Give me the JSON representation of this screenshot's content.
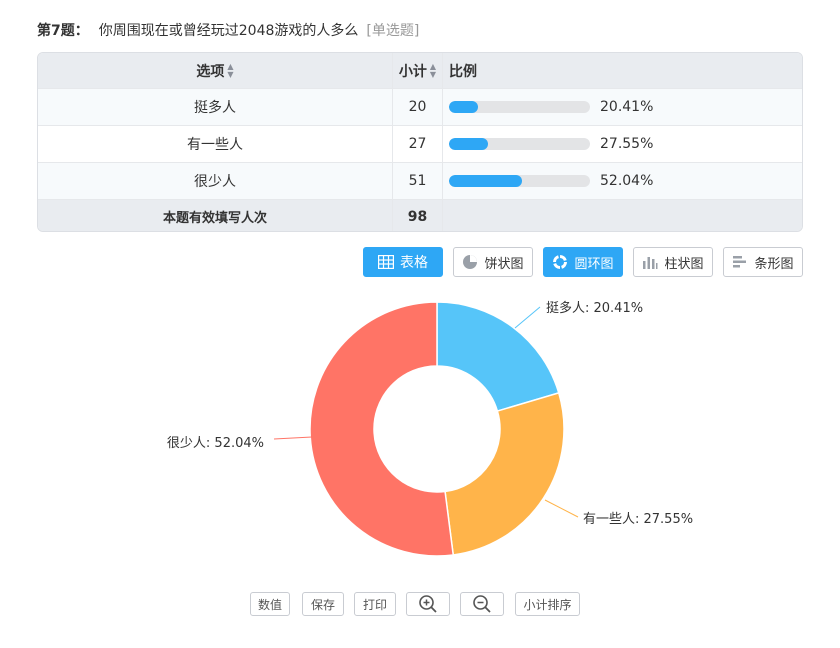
{
  "question": {
    "number": "第7题：",
    "text": "你周围现在或曾经玩过2048游戏的人多么",
    "type": "[单选题]"
  },
  "table": {
    "headers": {
      "option": "选项",
      "count": "小计",
      "ratio": "比例"
    },
    "rows": [
      {
        "option": "挺多人",
        "count": "20",
        "percent": "20.41%",
        "fraction": 0.2041
      },
      {
        "option": "有一些人",
        "count": "27",
        "percent": "27.55%",
        "fraction": 0.2755
      },
      {
        "option": "很少人",
        "count": "51",
        "percent": "52.04%",
        "fraction": 0.5204
      }
    ],
    "total": {
      "label": "本题有效填写人次",
      "count": "98"
    }
  },
  "view_buttons": {
    "table": "表格",
    "pie": "饼状图",
    "donut": "圆环图",
    "column": "柱状图",
    "bar": "条形图"
  },
  "tool_buttons": {
    "values": "数值",
    "save": "保存",
    "print": "打印",
    "sort": "小计排序"
  },
  "colors": {
    "accent": "#2ea7f5",
    "slice1": "#56c5f9",
    "slice2": "#ffb44a",
    "slice3": "#ff7466"
  },
  "chart_data": {
    "type": "pie",
    "variant": "donut",
    "categories": [
      "挺多人",
      "有一些人",
      "很少人"
    ],
    "values": [
      20.41,
      27.55,
      52.04
    ],
    "labels": [
      "挺多人: 20.41%",
      "有一些人: 27.55%",
      "很少人: 52.04%"
    ],
    "colors": [
      "#56c5f9",
      "#ffb44a",
      "#ff7466"
    ]
  }
}
